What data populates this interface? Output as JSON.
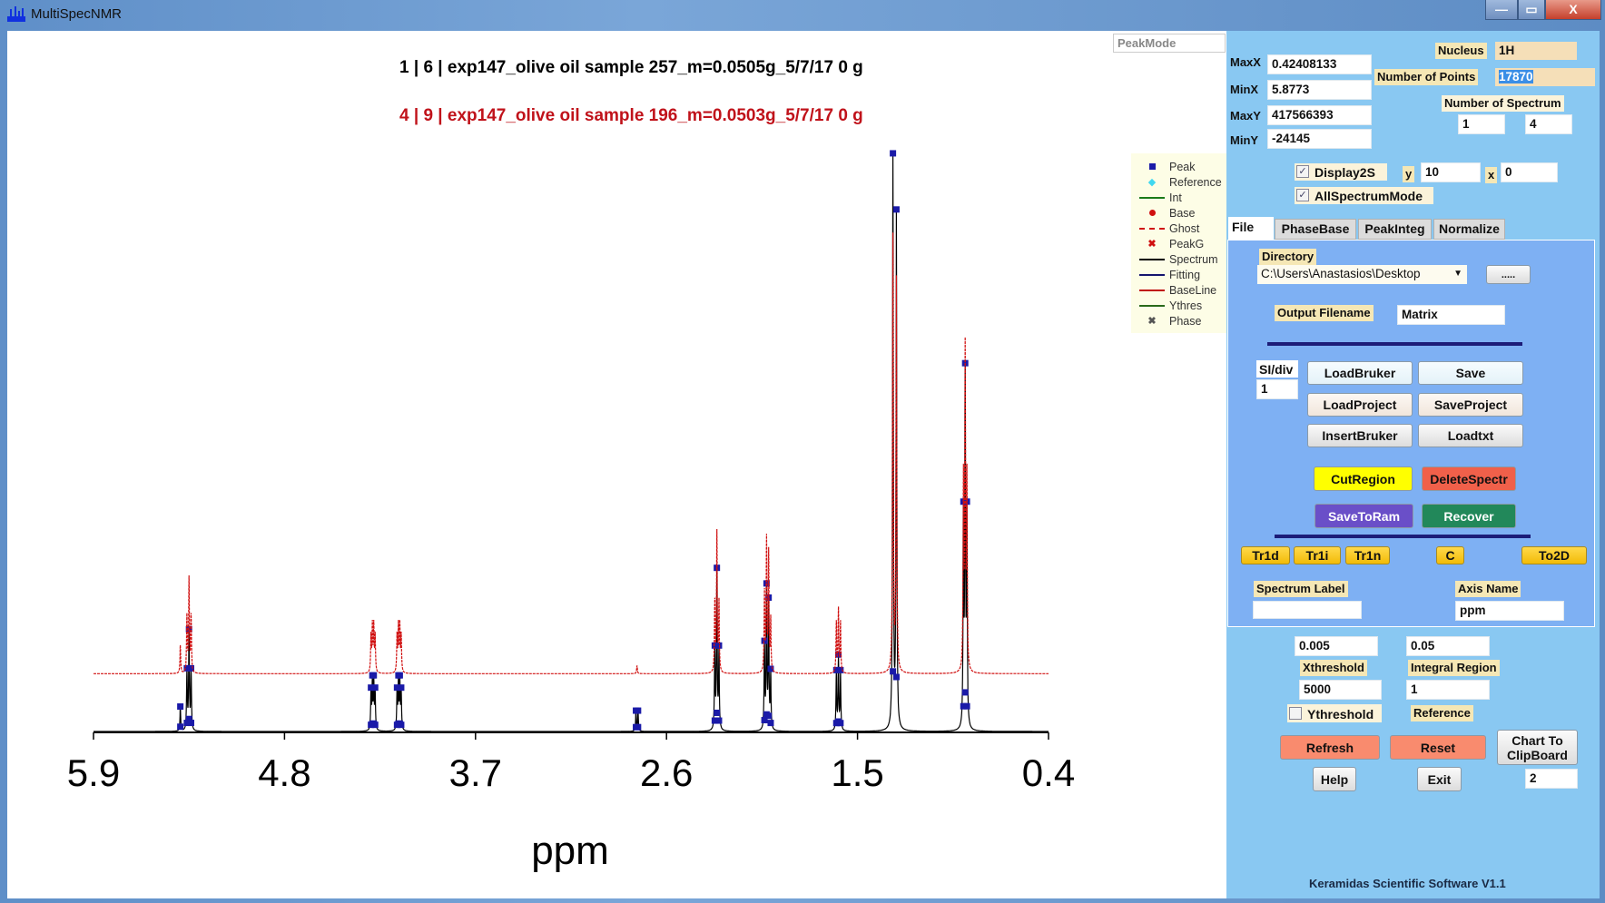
{
  "window": {
    "title": "MultiSpecNMR",
    "minimize": "—",
    "maximize": "▭",
    "close": "X"
  },
  "plot": {
    "peak_mode": "PeakMode",
    "titles": [
      {
        "text": "1 | 6 | exp147_olive oil sample 257_m=0.0505g_5/7/17 0 g",
        "color": "#111111"
      },
      {
        "text": "4 | 9 | exp147_olive oil sample 196_m=0.0503g_5/7/17 0 g",
        "color": "#c0121a"
      }
    ],
    "legend": [
      {
        "label": "Peak",
        "marker": "square",
        "color": "#1a1aa8"
      },
      {
        "label": "Reference",
        "marker": "diamond",
        "color": "#3fd8f0"
      },
      {
        "label": "Int",
        "marker": "line-dot",
        "color": "#1a7a1a"
      },
      {
        "label": "Base",
        "marker": "dot",
        "color": "#d01010"
      },
      {
        "label": "Ghost",
        "marker": "dashed",
        "color": "#d01010"
      },
      {
        "label": "PeakG",
        "marker": "cross",
        "color": "#d01010"
      },
      {
        "label": "Spectrum",
        "marker": "line",
        "color": "#000000"
      },
      {
        "label": "Fitting",
        "marker": "line",
        "color": "#14146e"
      },
      {
        "label": "BaseLine",
        "marker": "line",
        "color": "#c01010"
      },
      {
        "label": "Ythres",
        "marker": "line",
        "color": "#2a6a1a"
      },
      {
        "label": "Phase",
        "marker": "cross",
        "color": "#555555"
      }
    ]
  },
  "chart_data": {
    "type": "line",
    "xlabel": "ppm",
    "xlim": [
      5.9,
      0.4
    ],
    "x_reversed": true,
    "xticks": [
      "5.9",
      "4.8",
      "3.7",
      "2.6",
      "1.5",
      "0.4"
    ],
    "grid": false,
    "series": [
      {
        "color": "#000000",
        "offset_percent": 0,
        "peaks": [
          {
            "ppm": 5.35,
            "rel_intensity": 0.177,
            "multiplet": [
              [
                0,
                1
              ],
              [
                -0.012,
                0.6
              ],
              [
                0.012,
                0.6
              ],
              [
                0.05,
                0.25
              ]
            ]
          },
          {
            "ppm": 4.29,
            "rel_intensity": 0.097,
            "multiplet": [
              [
                -0.012,
                0.8
              ],
              [
                -0.004,
                1
              ],
              [
                0.004,
                1
              ],
              [
                0.012,
                0.8
              ]
            ]
          },
          {
            "ppm": 4.14,
            "rel_intensity": 0.097,
            "multiplet": [
              [
                -0.012,
                0.8
              ],
              [
                -0.004,
                1
              ],
              [
                0.004,
                1
              ],
              [
                0.012,
                0.8
              ]
            ]
          },
          {
            "ppm": 2.77,
            "rel_intensity": 0.036,
            "multiplet": [
              [
                -0.006,
                1
              ],
              [
                0.006,
                1
              ]
            ]
          },
          {
            "ppm": 2.31,
            "rel_intensity": 0.283,
            "multiplet": [
              [
                -0.012,
                0.5
              ],
              [
                0,
                1
              ],
              [
                0.012,
                0.5
              ]
            ]
          },
          {
            "ppm": 2.02,
            "rel_intensity": 0.256,
            "multiplet": [
              [
                -0.02,
                0.4
              ],
              [
                -0.008,
                0.9
              ],
              [
                0.004,
                1
              ],
              [
                0.016,
                0.6
              ]
            ]
          },
          {
            "ppm": 1.61,
            "rel_intensity": 0.133,
            "multiplet": [
              [
                -0.012,
                0.8
              ],
              [
                0,
                1
              ],
              [
                0.012,
                0.8
              ]
            ]
          },
          {
            "ppm": 1.29,
            "rel_intensity": 1.0,
            "multiplet": [
              [
                -0.014,
                0.9
              ],
              [
                0.006,
                1
              ]
            ]
          },
          {
            "ppm": 0.88,
            "rel_intensity": 0.637,
            "multiplet": [
              [
                -0.01,
                0.6
              ],
              [
                0,
                1
              ],
              [
                0.01,
                0.6
              ]
            ]
          }
        ]
      },
      {
        "color": "#d01010",
        "offset_percent": 10,
        "peaks": [
          {
            "ppm": 5.35,
            "rel_intensity": 0.17,
            "multiplet": [
              [
                0,
                1
              ],
              [
                -0.012,
                0.6
              ],
              [
                0.012,
                0.6
              ],
              [
                0.05,
                0.3
              ]
            ]
          },
          {
            "ppm": 4.29,
            "rel_intensity": 0.093,
            "multiplet": [
              [
                -0.012,
                0.8
              ],
              [
                -0.004,
                1
              ],
              [
                0.004,
                1
              ],
              [
                0.012,
                0.8
              ]
            ]
          },
          {
            "ppm": 4.14,
            "rel_intensity": 0.093,
            "multiplet": [
              [
                -0.012,
                0.8
              ],
              [
                -0.004,
                1
              ],
              [
                0.004,
                1
              ],
              [
                0.012,
                0.8
              ]
            ]
          },
          {
            "ppm": 2.77,
            "rel_intensity": 0.014,
            "multiplet": [
              [
                0,
                1
              ]
            ]
          },
          {
            "ppm": 2.31,
            "rel_intensity": 0.25,
            "multiplet": [
              [
                -0.012,
                0.5
              ],
              [
                0,
                1
              ],
              [
                0.012,
                0.5
              ]
            ]
          },
          {
            "ppm": 2.02,
            "rel_intensity": 0.242,
            "multiplet": [
              [
                -0.02,
                0.4
              ],
              [
                -0.008,
                0.9
              ],
              [
                0.004,
                1
              ],
              [
                0.016,
                0.6
              ]
            ]
          },
          {
            "ppm": 1.61,
            "rel_intensity": 0.116,
            "multiplet": [
              [
                -0.012,
                0.8
              ],
              [
                0,
                1
              ],
              [
                0.012,
                0.8
              ]
            ]
          },
          {
            "ppm": 1.29,
            "rel_intensity": 0.763,
            "multiplet": [
              [
                -0.014,
                0.9
              ],
              [
                0.006,
                1
              ]
            ]
          },
          {
            "ppm": 0.88,
            "rel_intensity": 0.582,
            "multiplet": [
              [
                -0.01,
                0.6
              ],
              [
                0,
                1
              ],
              [
                0.01,
                0.6
              ]
            ]
          }
        ]
      }
    ]
  },
  "panel": {
    "maxx_label": "MaxX",
    "maxx": "0.42408133",
    "minx_label": "MinX",
    "minx": "5.8773",
    "maxy_label": "MaxY",
    "maxy": "417566393",
    "miny_label": "MinY",
    "miny": "-24145",
    "nucleus_label": "Nucleus",
    "nucleus": "1H",
    "points_label": "Number of Points",
    "points": "17870",
    "nspec_label": "Number of Spectrum",
    "nspec_a": "1",
    "nspec_b": "4",
    "display2s_label": "Display2S",
    "display2s_checked": true,
    "y_label": "y",
    "y_value": "10",
    "x_label": "x",
    "x_value": "0",
    "allspec_label": "AllSpectrumMode",
    "allspec_checked": true,
    "tabs": [
      "File",
      "PhaseBase",
      "PeakInteg",
      "Normalize"
    ],
    "file": {
      "directory_label": "Directory",
      "directory": "C:\\Users\\Anastasios\\Desktop",
      "browse": ".....",
      "output_label": "Output Filename",
      "output": "Matrix",
      "sidiv_label": "SI/div",
      "sidiv": "1",
      "load_bruker": "LoadBruker",
      "save": "Save",
      "load_project": "LoadProject",
      "save_project": "SaveProject",
      "insert_bruker": "InsertBruker",
      "loadtxt": "Loadtxt",
      "cut_region": "CutRegion",
      "delete_spectr": "DeleteSpectr",
      "save_to_ram": "SaveToRam",
      "recover": "Recover",
      "tr1d": "Tr1d",
      "tr1i": "Tr1i",
      "tr1n": "Tr1n",
      "c": "C",
      "to2d": "To2D",
      "spectrum_label_label": "Spectrum Label",
      "spectrum_label": "",
      "axis_name_label": "Axis Name",
      "axis_name": "ppm"
    },
    "xthreshold_value": "0.005",
    "integral_value": "0.05",
    "xthreshold_label": "Xthreshold",
    "integral_label": "Integral Region",
    "ythreshold_value": "5000",
    "reference_value": "1",
    "ythreshold_label": "Ythreshold",
    "ythreshold_checked": false,
    "reference_label": "Reference",
    "refresh": "Refresh",
    "reset": "Reset",
    "clipboard_1": "Chart To",
    "clipboard_2": "ClipBoard",
    "help": "Help",
    "exit": "Exit",
    "copies": "2",
    "footer": "Keramidas Scientific Software V1.1",
    "colors": {
      "panel": "#89c8f2",
      "inner": "#7eb0f3",
      "gold": "#f2bb08",
      "delete": "#f0604a",
      "save_ram": "#6a4fc8",
      "recover": "#22885a",
      "refresh": "#f98b6e"
    }
  }
}
